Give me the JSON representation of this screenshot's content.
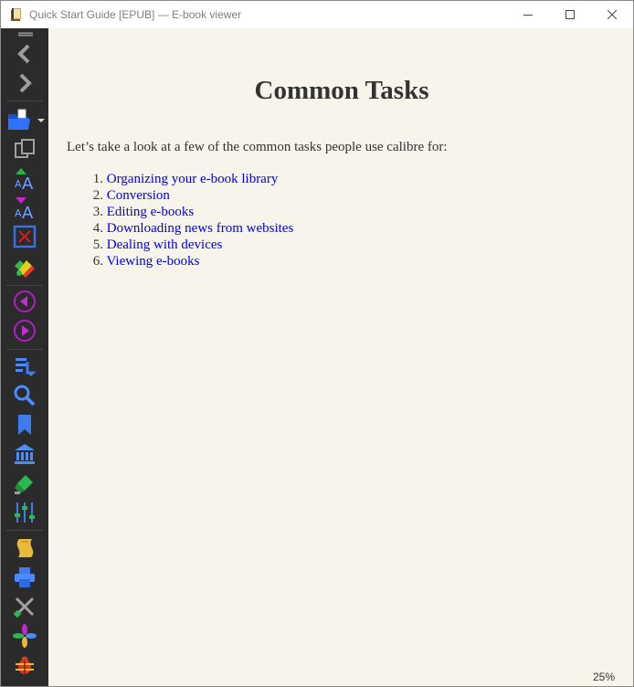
{
  "window": {
    "title": "Quick Start Guide [EPUB] — E-book viewer"
  },
  "toolbar": {
    "buttons": [
      {
        "name": "back",
        "icon": "chevron-left-icon"
      },
      {
        "name": "forward",
        "icon": "chevron-right-icon"
      },
      {
        "name": "open-book",
        "icon": "folder-open-icon"
      },
      {
        "name": "copy",
        "icon": "copy-icon"
      },
      {
        "name": "font-size-larger",
        "icon": "font-larger-icon"
      },
      {
        "name": "font-size-smaller",
        "icon": "font-smaller-icon"
      },
      {
        "name": "fullscreen",
        "icon": "fullscreen-icon"
      },
      {
        "name": "color-scheme",
        "icon": "paint-icon"
      },
      {
        "name": "previous-page",
        "icon": "previous-icon"
      },
      {
        "name": "next-page",
        "icon": "next-icon"
      },
      {
        "name": "toc",
        "icon": "table-of-contents-icon"
      },
      {
        "name": "search",
        "icon": "search-icon"
      },
      {
        "name": "bookmarks",
        "icon": "bookmark-icon"
      },
      {
        "name": "reference",
        "icon": "library-icon"
      },
      {
        "name": "highlight",
        "icon": "highlighter-icon"
      },
      {
        "name": "preferences",
        "icon": "sliders-icon"
      },
      {
        "name": "metadata",
        "icon": "scroll-icon"
      },
      {
        "name": "print",
        "icon": "print-icon"
      },
      {
        "name": "tools",
        "icon": "tools-icon"
      },
      {
        "name": "inspector",
        "icon": "pinwheel-icon"
      },
      {
        "name": "debug",
        "icon": "bug-icon"
      }
    ]
  },
  "page": {
    "heading": "Common Tasks",
    "intro": "Let’s take a look at a few of the common tasks people use calibre for:",
    "tasks": [
      {
        "num": "1.",
        "label": "Organizing your e-book library"
      },
      {
        "num": "2.",
        "label": "Conversion"
      },
      {
        "num": "3.",
        "label": "Editing e-books"
      },
      {
        "num": "4.",
        "label": "Downloading news from websites"
      },
      {
        "num": "5.",
        "label": "Dealing with devices"
      },
      {
        "num": "6.",
        "label": "Viewing e-books"
      }
    ]
  },
  "status": {
    "progress": "25%"
  },
  "colors": {
    "page_background": "#f6f4eb",
    "toolbar_background": "#2b2b2b",
    "link": "#0000ee",
    "text": "#333333"
  }
}
